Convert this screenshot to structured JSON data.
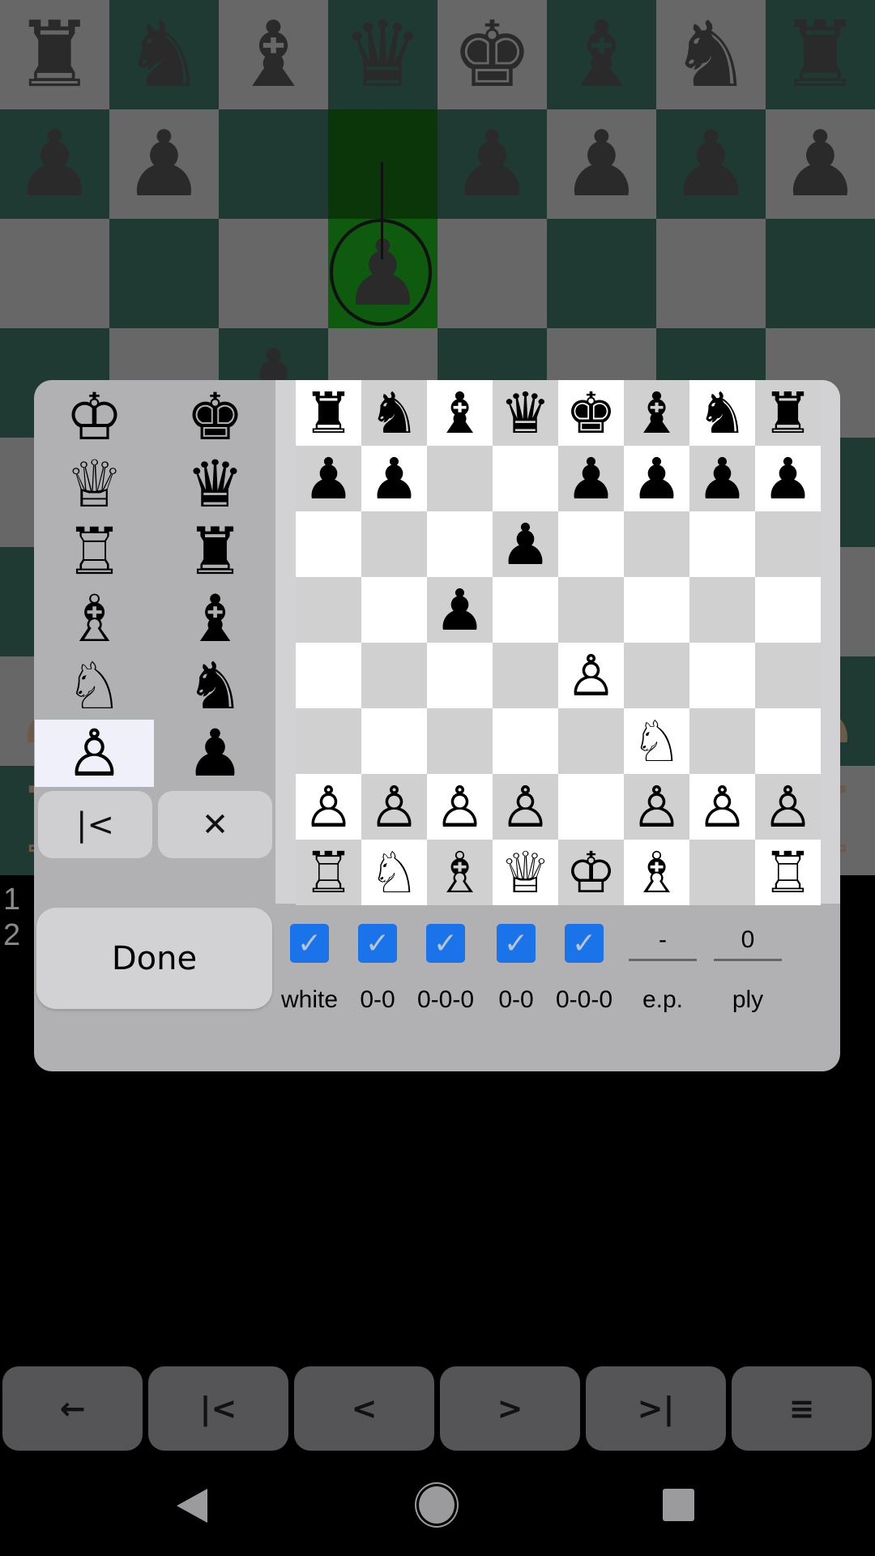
{
  "main_board": {
    "ranks": [
      "rnbqkbnr",
      "pp..pppp",
      "...p....",
      "..p.....",
      "....P...",
      ".....N..",
      "PPPP.PPP",
      "RNBQKB.R"
    ],
    "last_move_from": "d7",
    "last_move_to": "d6",
    "colors": {
      "light": "#676767",
      "dark": "#1e3a32",
      "highlight": "#0e5a0e"
    }
  },
  "move_list": [
    "1",
    "2"
  ],
  "edit_dialog": {
    "palette": {
      "white": [
        "K",
        "Q",
        "R",
        "B",
        "N",
        "P"
      ],
      "black": [
        "k",
        "q",
        "r",
        "b",
        "n",
        "p"
      ],
      "selected": "P"
    },
    "first_button_icon": "first-icon",
    "clear_button_icon": "close-icon",
    "done_label": "Done",
    "board": {
      "ranks": [
        "rnbqkbnr",
        "pp..pppp",
        "...p....",
        "..p.....",
        "....P...",
        ".....N..",
        "PPPP.PPP",
        "RNBQKB.R"
      ]
    },
    "options": [
      {
        "label": "white",
        "checked": true
      },
      {
        "label": "0-0",
        "checked": true
      },
      {
        "label": "0-0-0",
        "checked": true
      },
      {
        "label": "0-0",
        "checked": true
      },
      {
        "label": "0-0-0",
        "checked": true
      }
    ],
    "ep": {
      "label": "e.p.",
      "value": "-"
    },
    "ply": {
      "label": "ply",
      "value": "0"
    },
    "checkbox_color": "#1a73e8"
  },
  "toolbar": [
    {
      "icon": "back-arrow-icon",
      "glyph": "←"
    },
    {
      "icon": "first-move-icon",
      "glyph": "|<"
    },
    {
      "icon": "prev-move-icon",
      "glyph": "<"
    },
    {
      "icon": "next-move-icon",
      "glyph": ">"
    },
    {
      "icon": "last-move-icon",
      "glyph": ">|"
    },
    {
      "icon": "menu-icon",
      "glyph": "≡"
    }
  ],
  "nav_bar": [
    "back",
    "home",
    "recents"
  ]
}
